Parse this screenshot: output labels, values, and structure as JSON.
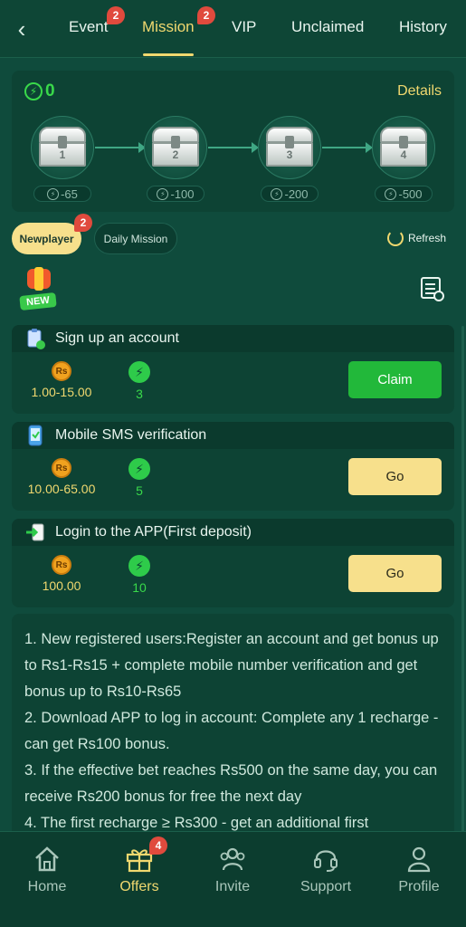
{
  "topbar": {
    "tabs": [
      {
        "label": "Event",
        "badge": "2"
      },
      {
        "label": "Mission",
        "badge": "2"
      },
      {
        "label": "VIP"
      },
      {
        "label": "Unclaimed"
      },
      {
        "label": "History"
      }
    ],
    "active_tab": "Mission"
  },
  "chest_panel": {
    "energy": "0",
    "details_label": "Details",
    "chests": [
      {
        "number": "1",
        "cost": "-65"
      },
      {
        "number": "2",
        "cost": "-100"
      },
      {
        "number": "3",
        "cost": "-200"
      },
      {
        "number": "4",
        "cost": "-500"
      }
    ]
  },
  "subtabs": {
    "newplayer": "Newplayer",
    "newplayer_badge": "2",
    "daily": "Daily Mission",
    "refresh": "Refresh"
  },
  "new_badge": "NEW",
  "missions": [
    {
      "title": "Sign up an account",
      "rs_icon": "Rs",
      "rs_value": "1.00-15.00",
      "energy_value": "3",
      "button": "Claim"
    },
    {
      "title": "Mobile SMS verification",
      "rs_icon": "Rs",
      "rs_value": "10.00-65.00",
      "energy_value": "5",
      "button": "Go"
    },
    {
      "title": "Login to the APP(First deposit)",
      "rs_icon": "Rs",
      "rs_value": "100.00",
      "energy_value": "10",
      "button": "Go"
    }
  ],
  "rules": [
    "1. New registered users:Register an account and get bonus up to Rs1-Rs15 + complete mobile number verification and get bonus up to Rs10-Rs65",
    "2. Download APP to log in account: Complete any 1 recharge - can get Rs100 bonus.",
    "3. If the effective bet reaches Rs500 on the same day, you can receive Rs200 bonus for free the next day",
    "4. The first recharge ≥ Rs300 - get an additional first"
  ],
  "bottom_nav": [
    {
      "label": "Home",
      "icon": "home-icon"
    },
    {
      "label": "Offers",
      "icon": "gift-icon",
      "badge": "4"
    },
    {
      "label": "Invite",
      "icon": "people-icon"
    },
    {
      "label": "Support",
      "icon": "headset-icon"
    },
    {
      "label": "Profile",
      "icon": "person-icon"
    }
  ],
  "colors": {
    "background": "#0f4b3c",
    "accent_gold": "#f0d86f",
    "energy_green": "#39d94a",
    "badge_red": "#e04a3d",
    "claim_green": "#22b83a"
  }
}
